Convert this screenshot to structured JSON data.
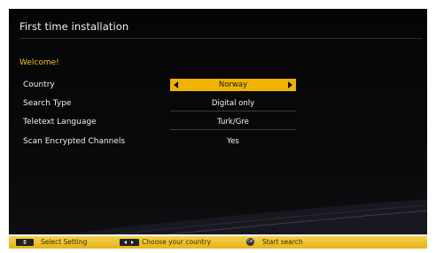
{
  "screen": {
    "title": "First time installation",
    "welcome": "Welcome!",
    "rows": [
      {
        "label": "Country",
        "value": "Norway"
      },
      {
        "label": "Search Type",
        "value": "Digital only"
      },
      {
        "label": "Teletext Language",
        "value": "Turk/Gre"
      },
      {
        "label": "Scan Encrypted Channels",
        "value": "Yes"
      }
    ]
  },
  "footer": {
    "select_setting": "Select Setting",
    "choose_country": "Choose your country",
    "ok_label": "OK",
    "start_search": "Start search"
  },
  "colors": {
    "accent": "#f0b400",
    "welcome_text": "#f2c21f",
    "footer_bg": "#e8c02a"
  },
  "icons": [
    "left-arrow-icon",
    "right-arrow-icon",
    "up-down-key-icon",
    "left-right-key-icon",
    "ok-button-icon"
  ]
}
